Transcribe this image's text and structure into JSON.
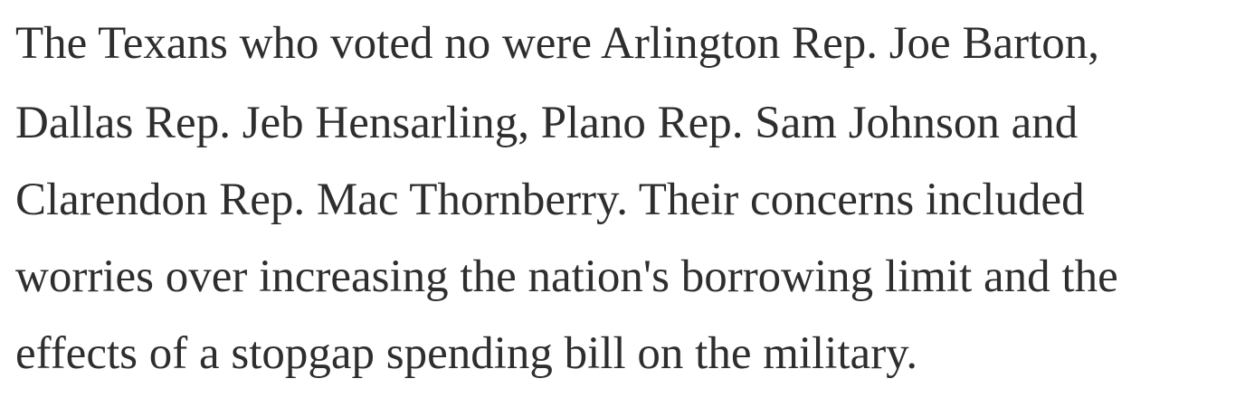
{
  "article": {
    "paragraph": {
      "lines": [
        "The Texans who voted no were Arlington Rep. Joe Barton,",
        "Dallas Rep. Jeb Hensarling, Plano Rep. Sam Johnson and",
        "Clarendon Rep. Mac Thornberry. Their concerns included",
        "worries over increasing the nation's borrowing limit and the",
        "effects of a stopgap spending bill on the military."
      ]
    },
    "colors": {
      "text": "#2e2e2e",
      "background": "#ffffff"
    }
  }
}
